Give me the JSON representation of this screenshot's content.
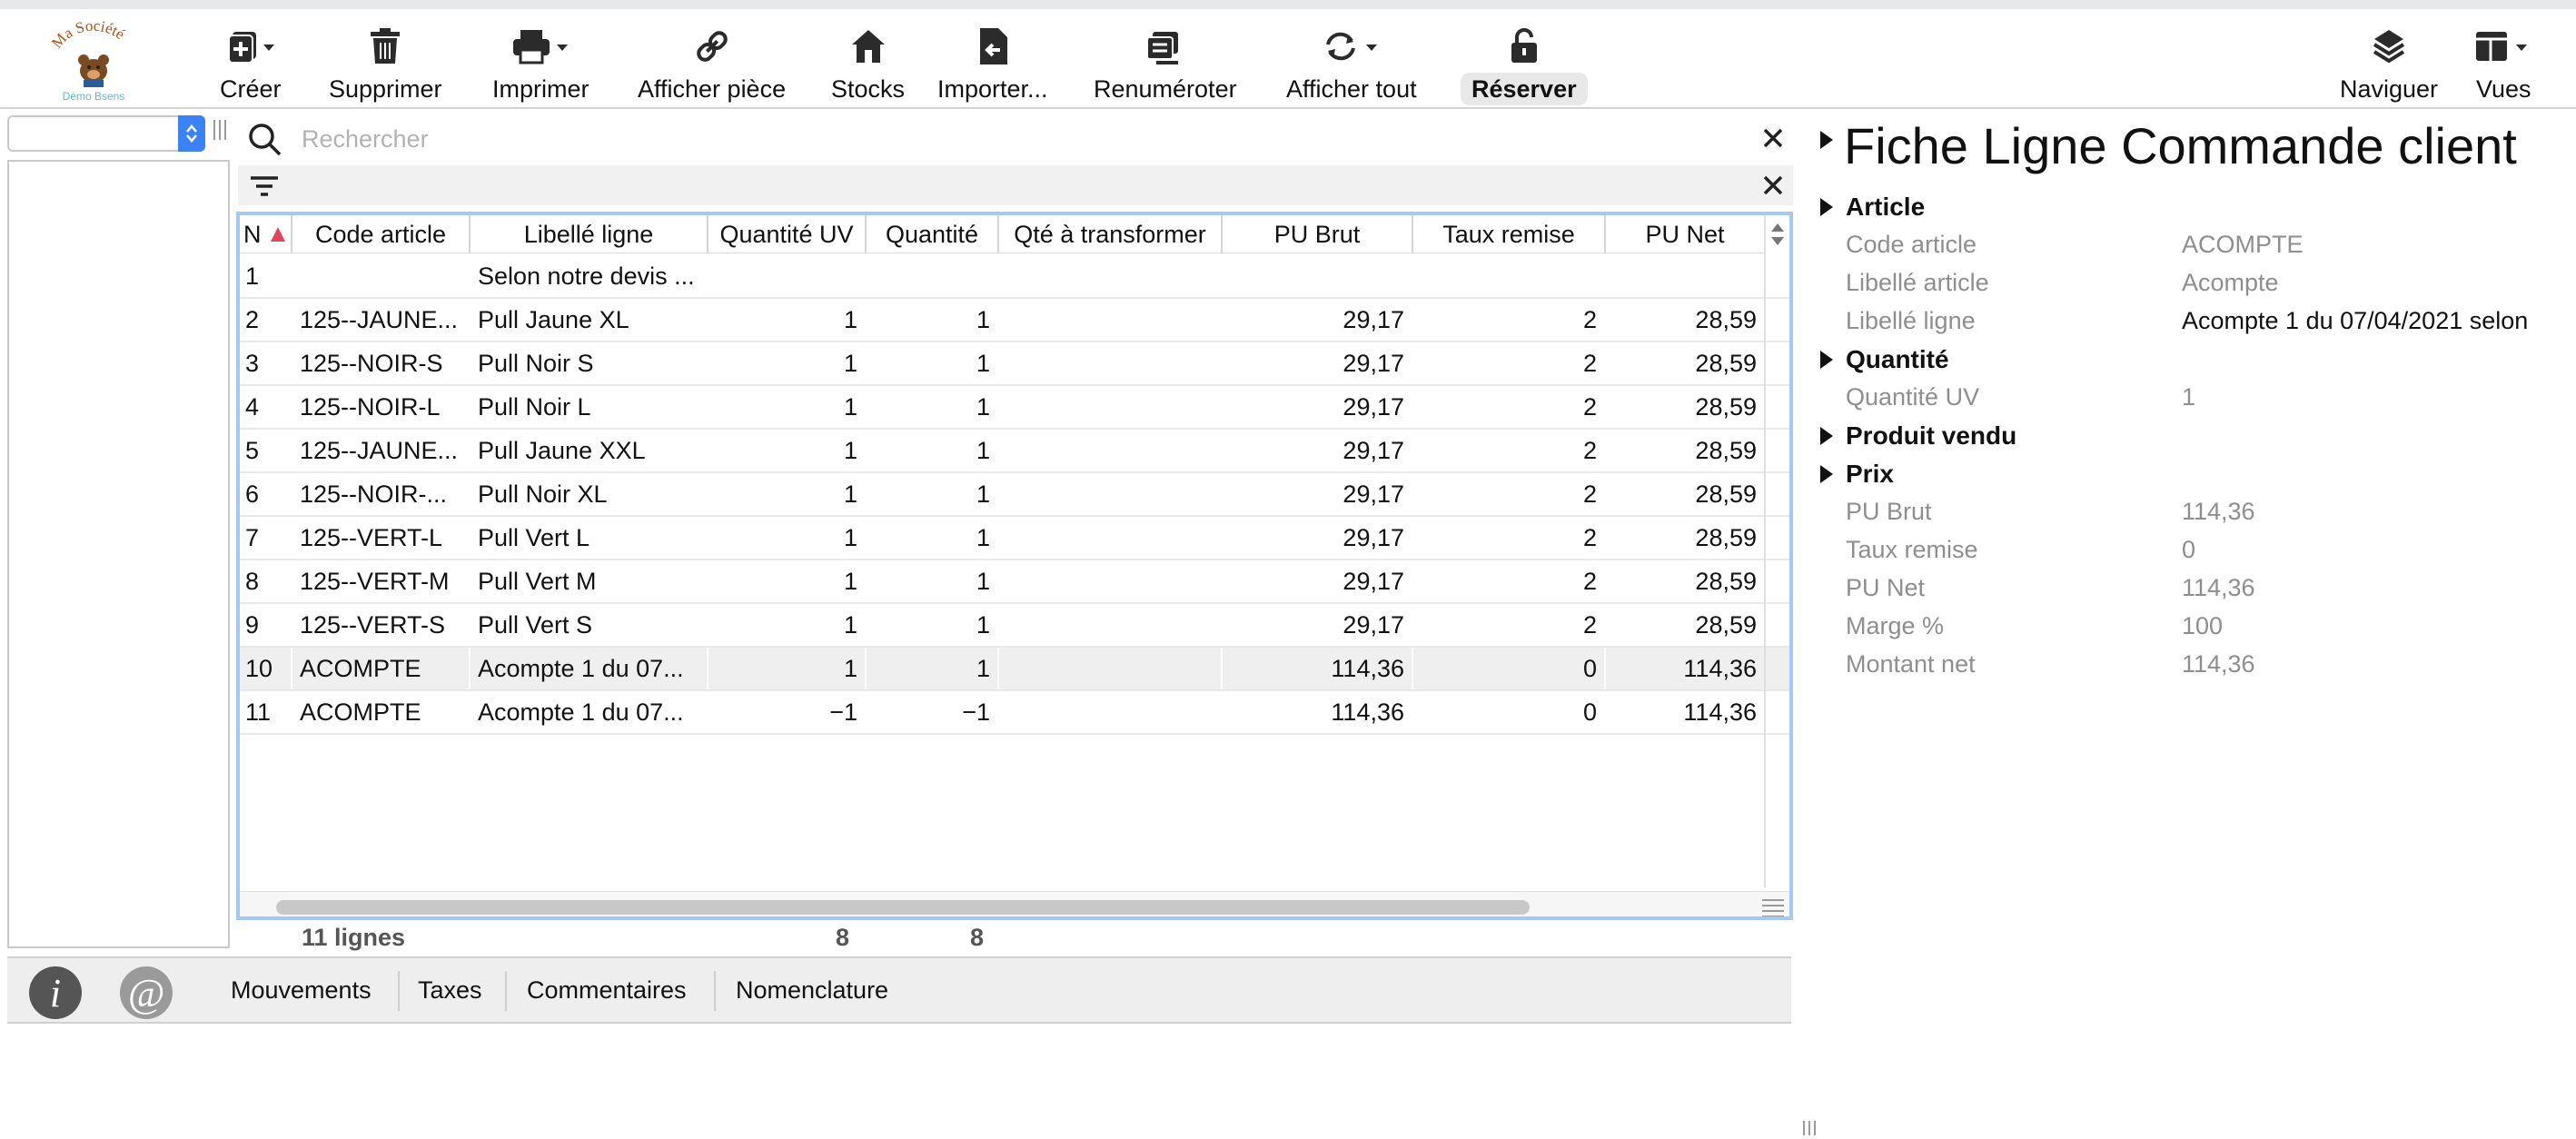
{
  "logo": {
    "line1": "Ma Société",
    "line2": "Démo Bsens"
  },
  "toolbar": {
    "creer": "Créer",
    "supprimer": "Supprimer",
    "imprimer": "Imprimer",
    "afficher_piece": "Afficher pièce",
    "stocks": "Stocks",
    "importer": "Importer...",
    "renumeroter": "Renuméroter",
    "afficher_tout": "Afficher tout",
    "reserver": "Réserver",
    "naviguer": "Naviguer",
    "vues": "Vues"
  },
  "search": {
    "placeholder": "Rechercher"
  },
  "table": {
    "headers": [
      "N",
      "Code article",
      "Libellé ligne",
      "Quantité UV",
      "Quantité",
      "Qté à transformer",
      "PU Brut",
      "Taux remise",
      "PU Net"
    ],
    "rows": [
      [
        "1",
        "",
        "Selon notre devis ...",
        "",
        "",
        "",
        "",
        "",
        ""
      ],
      [
        "2",
        "125--JAUNE...",
        "Pull  Jaune XL",
        "1",
        "1",
        "",
        "29,17",
        "2",
        "28,59"
      ],
      [
        "3",
        "125--NOIR-S",
        "Pull  Noir S",
        "1",
        "1",
        "",
        "29,17",
        "2",
        "28,59"
      ],
      [
        "4",
        "125--NOIR-L",
        "Pull  Noir L",
        "1",
        "1",
        "",
        "29,17",
        "2",
        "28,59"
      ],
      [
        "5",
        "125--JAUNE...",
        "Pull  Jaune XXL",
        "1",
        "1",
        "",
        "29,17",
        "2",
        "28,59"
      ],
      [
        "6",
        "125--NOIR-...",
        "Pull  Noir XL",
        "1",
        "1",
        "",
        "29,17",
        "2",
        "28,59"
      ],
      [
        "7",
        "125--VERT-L",
        "Pull  Vert L",
        "1",
        "1",
        "",
        "29,17",
        "2",
        "28,59"
      ],
      [
        "8",
        "125--VERT-M",
        "Pull  Vert M",
        "1",
        "1",
        "",
        "29,17",
        "2",
        "28,59"
      ],
      [
        "9",
        "125--VERT-S",
        "Pull  Vert S",
        "1",
        "1",
        "",
        "29,17",
        "2",
        "28,59"
      ],
      [
        "10",
        "ACOMPTE",
        "Acompte 1 du 07...",
        "1",
        "1",
        "",
        "114,36",
        "0",
        "114,36"
      ],
      [
        "11",
        "ACOMPTE",
        "Acompte 1 du 07...",
        "−1",
        "−1",
        "",
        "114,36",
        "0",
        "114,36"
      ]
    ],
    "selected_row": 10
  },
  "summary": {
    "lines": "11 lignes",
    "qte_uv_total": "8",
    "qte_total": "8"
  },
  "tabs": {
    "info_glyph": "i",
    "at_glyph": "@",
    "items": [
      "Mouvements",
      "Taxes",
      "Commentaires",
      "Nomenclature"
    ]
  },
  "detail": {
    "title": "Fiche Ligne Commande client",
    "sections": {
      "article": "Article",
      "quantite": "Quantité",
      "produit_vendu": "Produit vendu",
      "prix": "Prix"
    },
    "fields": {
      "code_article": {
        "label": "Code article",
        "value": "ACOMPTE"
      },
      "libelle_article": {
        "label": "Libellé article",
        "value": "Acompte"
      },
      "libelle_ligne": {
        "label": "Libellé ligne",
        "value": "Acompte 1 du 07/04/2021 selon"
      },
      "quantite_uv": {
        "label": "Quantité UV",
        "value": "1"
      },
      "pu_brut": {
        "label": "PU Brut",
        "value": "114,36"
      },
      "taux_remise": {
        "label": "Taux remise",
        "value": "0"
      },
      "pu_net": {
        "label": "PU Net",
        "value": "114,36"
      },
      "marge": {
        "label": "Marge %",
        "value": "100"
      },
      "montant_net": {
        "label": "Montant net",
        "value": "114,36"
      }
    }
  },
  "colors": {
    "accent": "#3b82f6",
    "table_border": "#a8c8f4",
    "sort_arrow": "#e0455a",
    "label_gray": "#8e8e8e"
  }
}
